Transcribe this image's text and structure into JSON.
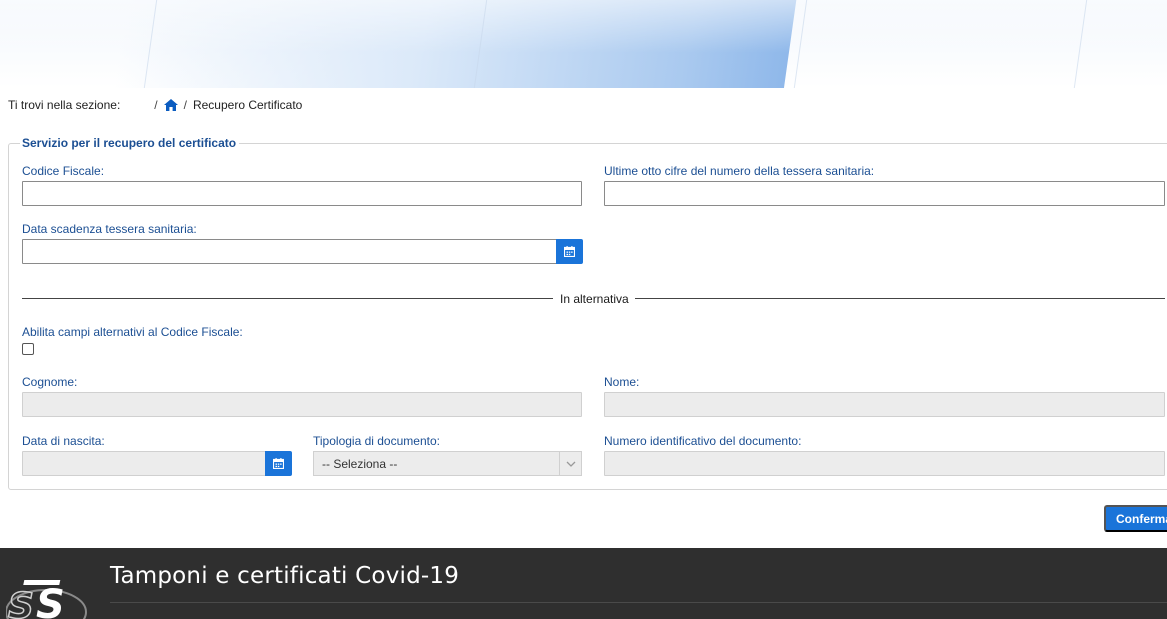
{
  "breadcrumb": {
    "prefix": "Ti trovi nella sezione:",
    "separator": "/",
    "current": "Recupero Certificato"
  },
  "form": {
    "legend": "Servizio per il recupero del certificato",
    "codice_fiscale": {
      "label": "Codice Fiscale:",
      "value": ""
    },
    "ultime_cifre": {
      "label": "Ultime otto cifre del numero della tessera sanitaria:",
      "value": ""
    },
    "data_scadenza": {
      "label": "Data scadenza tessera sanitaria:",
      "value": ""
    },
    "alternativa_label": "In alternativa",
    "abilita_label": "Abilita campi alternativi al Codice Fiscale:",
    "cognome": {
      "label": "Cognome:",
      "value": ""
    },
    "nome": {
      "label": "Nome:",
      "value": ""
    },
    "data_nascita": {
      "label": "Data di nascita:",
      "value": ""
    },
    "tipologia": {
      "label": "Tipologia di documento:",
      "selected": "-- Seleziona --"
    },
    "numero_documento": {
      "label": "Numero identificativo del documento:",
      "value": ""
    }
  },
  "actions": {
    "confirm_label": "Conferma"
  },
  "footer": {
    "title": "Tamponi e certificati Covid-19",
    "logo_text": "STS"
  },
  "colors": {
    "accent": "#1a74d9",
    "label": "#1c4f93",
    "footer_bg": "#2f2f2f"
  }
}
